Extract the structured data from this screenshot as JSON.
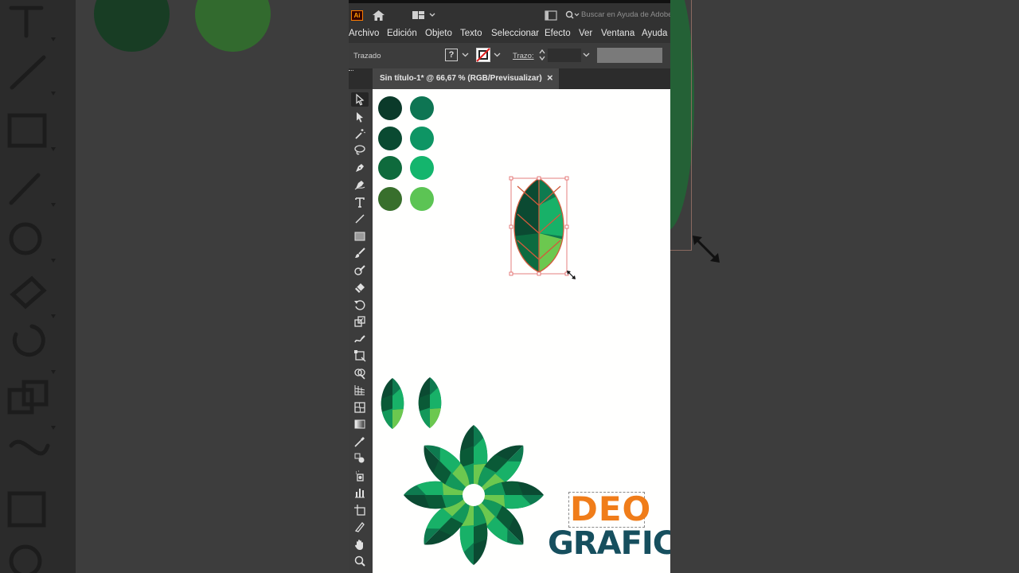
{
  "app": {
    "logo_text": "Ai",
    "search_placeholder": "Buscar en Ayuda de Adobe"
  },
  "menu": [
    "Archivo",
    "Edición",
    "Objeto",
    "Texto",
    "Seleccionar",
    "Efecto",
    "Ver",
    "Ventana",
    "Ayuda"
  ],
  "control_bar": {
    "selection_label": "Trazado",
    "stroke_label": "Trazo:",
    "fill_unknown": "?"
  },
  "document_tab": {
    "title": "Sin título-1* @ 66,67 % (RGB/Previsualizar)",
    "close": "×"
  },
  "swatches": {
    "left_column": [
      "#0b3a2a",
      "#0a4a31",
      "#0e6a3c",
      "#386f2c"
    ],
    "right_column": [
      "#0e7553",
      "#0e9564",
      "#14b56d",
      "#5cc454"
    ]
  },
  "leaf_colors": {
    "dark": "#0b4a32",
    "mid": "#0e7a4f",
    "light": "#18b168",
    "lime": "#6cc84f",
    "vein": "#d25a3c"
  },
  "watermark": {
    "top": "DEO",
    "bottom": "GRAFIC",
    "orange": "#f07d1a",
    "teal": "#164f5e"
  }
}
